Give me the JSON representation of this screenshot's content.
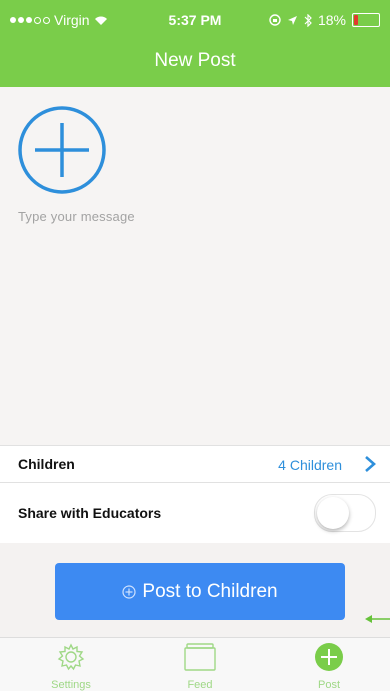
{
  "status_bar": {
    "carrier": "Virgin",
    "time": "5:37 PM",
    "battery": "18%",
    "battery_level": 0.18
  },
  "header": {
    "title": "New Post"
  },
  "compose": {
    "add_icon": "plus-circle-icon",
    "message_placeholder": "Type your message"
  },
  "children_row": {
    "label": "Children",
    "value": "4 Children"
  },
  "share_row": {
    "label": "Share with Educators",
    "toggle_on": false
  },
  "post_button": {
    "label": "Post to Children"
  },
  "tabs": [
    {
      "label": "Settings",
      "icon": "gear-icon"
    },
    {
      "label": "Feed",
      "icon": "feed-icon"
    },
    {
      "label": "Post",
      "icon": "plus-circle-icon"
    }
  ],
  "colors": {
    "brand_green": "#7acd4a",
    "accent_blue": "#2e8fdb",
    "button_blue": "#3d8af2",
    "tab_green": "#9fd886"
  }
}
